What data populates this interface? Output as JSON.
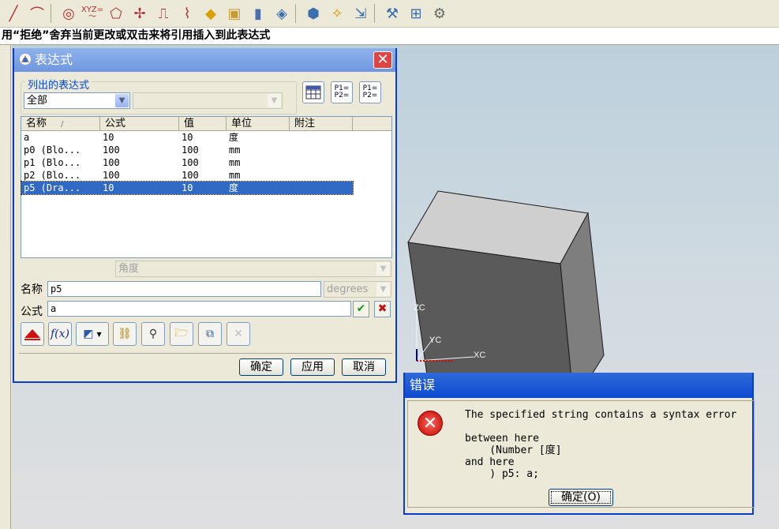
{
  "cue_line": "用“拒绝”舍弃当前更改或双击来将引用插入到此表达式",
  "toolbar": {
    "icons": [
      "line-icon",
      "arc-icon",
      "spline-icon",
      "xyz-curve-icon",
      "shape-icon",
      "point-icon",
      "offset-icon",
      "sweep-icon",
      "block-icon",
      "box-icon",
      "cylinder-icon",
      "feature-icon",
      "solid-icon",
      "assembly-icon",
      "export-icon",
      "tools-icon",
      "measure-icon",
      "render-icon"
    ],
    "xyz_label": "XYZ="
  },
  "expressions_dialog": {
    "title": "表达式",
    "close": "✕",
    "listed_group_label": "列出的表达式",
    "filter_value": "全部",
    "secondary_filter_value": "",
    "columns": [
      "名称",
      "公式",
      "值",
      "单位",
      "附注"
    ],
    "sort_indicator": "/",
    "rows": [
      {
        "name": "a",
        "formula": "10",
        "value": "10",
        "unit": "度",
        "note": ""
      },
      {
        "name": "p0  (Blo...",
        "formula": "100",
        "value": "100",
        "unit": "mm",
        "note": ""
      },
      {
        "name": "p1  (Blo...",
        "formula": "100",
        "value": "100",
        "unit": "mm",
        "note": ""
      },
      {
        "name": "p2  (Blo...",
        "formula": "100",
        "value": "100",
        "unit": "mm",
        "note": ""
      },
      {
        "name": "p5  (Dra...",
        "formula": "10",
        "value": "10",
        "unit": "度",
        "note": "",
        "selected": true
      }
    ],
    "dimension_type": "角度",
    "name_label": "名称",
    "name_value": "p5",
    "unit_value": "degrees",
    "formula_label": "公式",
    "formula_value": "a",
    "accept_symbol": "✔",
    "reject_symbol": "✖",
    "tool_icons": [
      "delete-icon",
      "function-icon",
      "measure-icon",
      "link-icon",
      "find-icon",
      "open-folder-icon",
      "export-icon",
      "disabled-x-icon"
    ],
    "function_label": "f(x)",
    "side_icons": [
      "spreadsheet-icon",
      "p1-p2-import-icon",
      "p1-p2-export-icon"
    ],
    "p1_label": "P1=",
    "p2_label": "P2=",
    "buttons": {
      "ok": "确定",
      "apply": "应用",
      "cancel": "取消"
    }
  },
  "graphics": {
    "triad": {
      "z": "ZC",
      "y": "YC",
      "x": "XC"
    },
    "cube_colors": {
      "top": "#cfcfcf",
      "front": "#5a5a5a",
      "side": "#7e7e7e",
      "edge": "#1a1a1a"
    }
  },
  "error_dialog": {
    "title": "错误",
    "icon_symbol": "✕",
    "message": "The specified string contains a syntax error\n\nbetween here\n    (Number [度]\nand here\n    ) p5: a;",
    "ok_button": "确定(O)"
  }
}
